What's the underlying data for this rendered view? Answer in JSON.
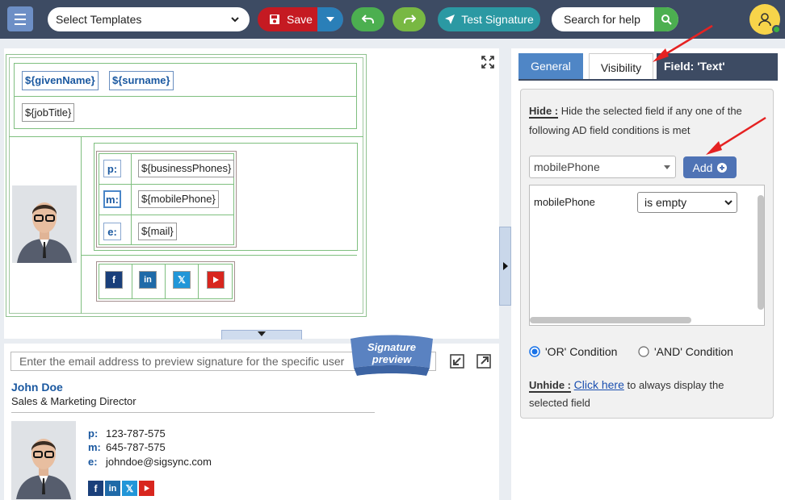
{
  "topbar": {
    "template_select": "Select Templates",
    "save_label": "Save",
    "test_label": "Test Signature",
    "search_placeholder": "Search for help"
  },
  "editor": {
    "given_name": "${givenName}",
    "surname": "${surname}",
    "job_title": "${jobTitle}",
    "phone_label": "p:",
    "phone_field": "${businessPhones}",
    "mobile_label": "m:",
    "mobile_field": "${mobilePhone}",
    "email_label": "e:",
    "email_field": "${mail}"
  },
  "preview": {
    "input_placeholder": "Enter the email address to preview signature for the specific user",
    "ribbon_line1": "Signature",
    "ribbon_line2": "preview",
    "name": "John Doe",
    "title": "Sales & Marketing Director",
    "phone_label": "p:",
    "phone": "123-787-575",
    "mobile_label": "m:",
    "mobile": "645-787-575",
    "email_label": "e:",
    "email": "johndoe@sigsync.com"
  },
  "panel": {
    "tabs": [
      "General",
      "Visibility",
      "Field: 'Text'"
    ],
    "hide_label": "Hide :",
    "hide_text": "Hide the selected field if any one of the following AD field conditions is met",
    "field_select": "mobilePhone",
    "add_label": "Add",
    "condition_field": "mobilePhone",
    "condition_op": "is empty",
    "or_label": "'OR' Condition",
    "and_label": "'AND' Condition",
    "unhide_label": "Unhide :",
    "click_here": "Click here",
    "unhide_text": "to always display the selected field"
  },
  "colors": {
    "topbar": "#3d4b63",
    "accent": "#1a58a0",
    "save": "#c51a22",
    "add": "#4f73b5"
  }
}
